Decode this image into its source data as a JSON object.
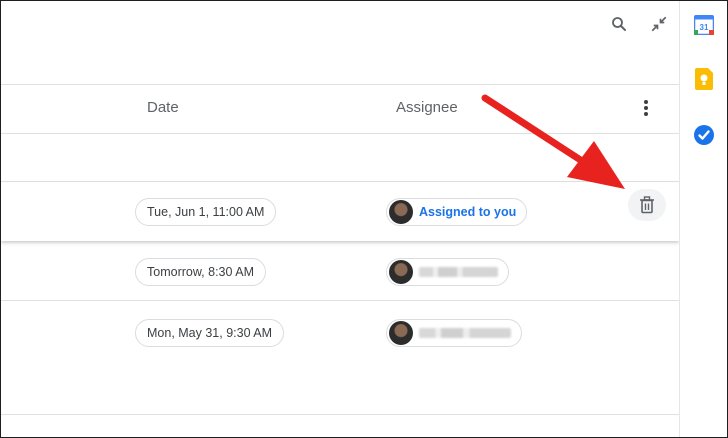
{
  "toolbar": {
    "search_icon": "search-icon",
    "collapse_icon": "collapse-icon"
  },
  "table": {
    "columns": [
      {
        "label": "Date"
      },
      {
        "label": "Assignee"
      }
    ],
    "more_icon": "more-vert-icon",
    "rows": [
      {
        "date": "Tue, Jun 1, 11:00 AM",
        "assignee": "Assigned to you",
        "assignee_name_visible": true,
        "selected": true
      },
      {
        "date": "Tomorrow, 8:30 AM",
        "assignee": "",
        "assignee_name_visible": false,
        "selected": false
      },
      {
        "date": "Mon, May 31, 9:30 AM",
        "assignee": "",
        "assignee_name_visible": false,
        "selected": false
      }
    ],
    "delete_icon": "trash-icon"
  },
  "side_panel": {
    "apps": [
      {
        "name": "calendar-icon",
        "text": "31",
        "color": "#4285f4"
      },
      {
        "name": "keep-icon",
        "color": "#fbbc04"
      },
      {
        "name": "tasks-icon",
        "color": "#1a73e8"
      }
    ]
  },
  "annotation": {
    "arrow_color": "#e8231f"
  }
}
